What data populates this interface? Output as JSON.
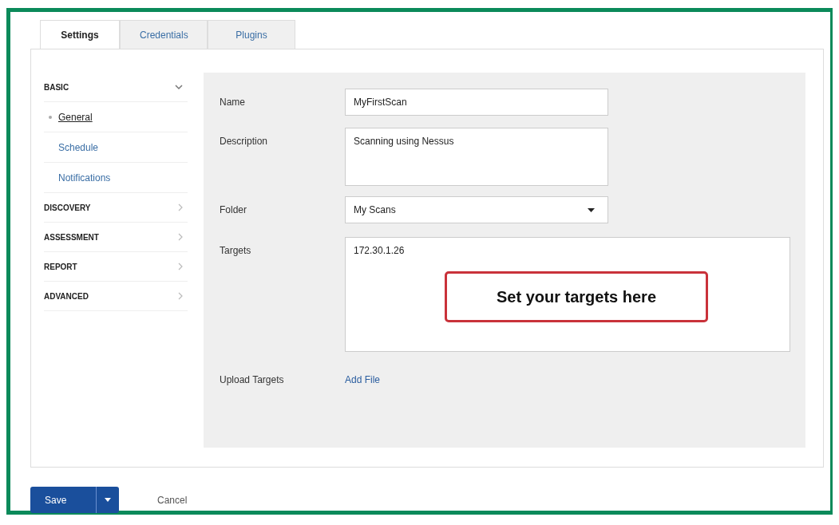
{
  "tabs": [
    {
      "label": "Settings",
      "selected": true
    },
    {
      "label": "Credentials",
      "selected": false
    },
    {
      "label": "Plugins",
      "selected": false
    }
  ],
  "sidebar": {
    "sections": [
      {
        "label": "BASIC",
        "expanded": true,
        "items": [
          {
            "label": "General",
            "selected": true
          },
          {
            "label": "Schedule",
            "selected": false
          },
          {
            "label": "Notifications",
            "selected": false
          }
        ]
      },
      {
        "label": "DISCOVERY",
        "expanded": false
      },
      {
        "label": "ASSESSMENT",
        "expanded": false
      },
      {
        "label": "REPORT",
        "expanded": false
      },
      {
        "label": "ADVANCED",
        "expanded": false
      }
    ]
  },
  "form": {
    "fields": [
      {
        "kind": "text",
        "label": "Name",
        "value": "MyFirstScan"
      },
      {
        "kind": "textarea",
        "label": "Description",
        "value": "Scanning using Nessus"
      },
      {
        "kind": "select",
        "label": "Folder",
        "value": "My Scans"
      },
      {
        "kind": "targets",
        "label": "Targets",
        "value": "172.30.1.26",
        "callout": "Set your targets here"
      },
      {
        "kind": "link",
        "label": "Upload Targets",
        "value": "Add File"
      }
    ]
  },
  "buttons": {
    "save": "Save",
    "cancel": "Cancel"
  }
}
